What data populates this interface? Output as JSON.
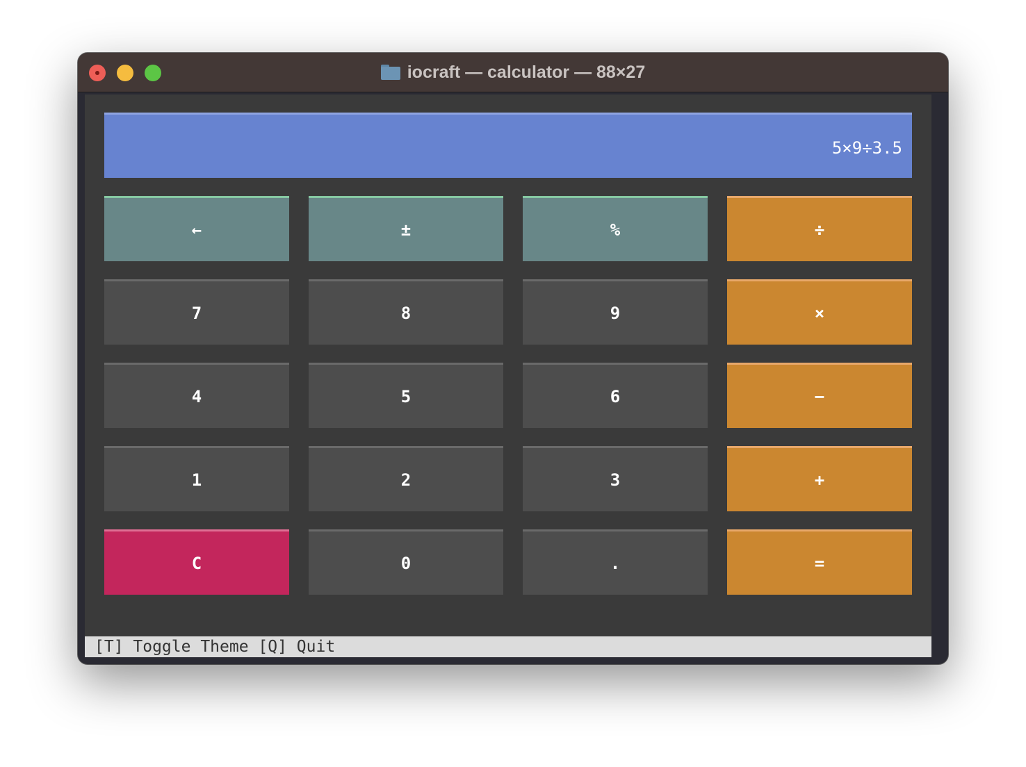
{
  "window": {
    "title": "iocraft — calculator — 88×27",
    "colors": {
      "display": "#6783d0",
      "function_key": "#688788",
      "digit_key": "#4d4d4d",
      "operator_key": "#cb8730",
      "clear_key": "#c3265c"
    }
  },
  "display": {
    "value": "5×9÷3.5"
  },
  "keypad": {
    "rows": [
      [
        {
          "label": "←",
          "kind": "func"
        },
        {
          "label": "±",
          "kind": "func"
        },
        {
          "label": "%",
          "kind": "func"
        },
        {
          "label": "÷",
          "kind": "op"
        }
      ],
      [
        {
          "label": "7",
          "kind": "digit"
        },
        {
          "label": "8",
          "kind": "digit"
        },
        {
          "label": "9",
          "kind": "digit"
        },
        {
          "label": "×",
          "kind": "op"
        }
      ],
      [
        {
          "label": "4",
          "kind": "digit"
        },
        {
          "label": "5",
          "kind": "digit"
        },
        {
          "label": "6",
          "kind": "digit"
        },
        {
          "label": "−",
          "kind": "op"
        }
      ],
      [
        {
          "label": "1",
          "kind": "digit"
        },
        {
          "label": "2",
          "kind": "digit"
        },
        {
          "label": "3",
          "kind": "digit"
        },
        {
          "label": "+",
          "kind": "op"
        }
      ],
      [
        {
          "label": "C",
          "kind": "clear"
        },
        {
          "label": "0",
          "kind": "digit"
        },
        {
          "label": ".",
          "kind": "digit"
        },
        {
          "label": "=",
          "kind": "op"
        }
      ]
    ]
  },
  "footer": {
    "hint": "[T] Toggle Theme [Q] Quit"
  }
}
